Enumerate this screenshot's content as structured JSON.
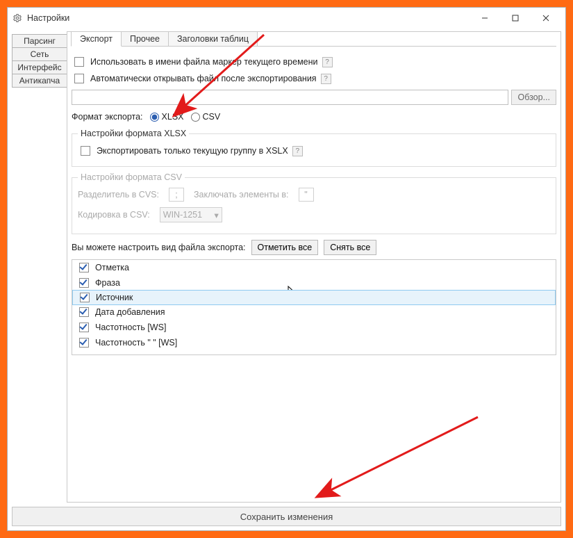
{
  "window": {
    "title": "Настройки",
    "controls": {
      "min": "–",
      "max": "☐",
      "close": "✕"
    }
  },
  "side_tabs": [
    "Парсинг",
    "Сеть",
    "Интерфейс",
    "Антикапча"
  ],
  "top_tabs": [
    "Экспорт",
    "Прочее",
    "Заголовки таблиц"
  ],
  "export": {
    "use_time_marker_label": "Использовать в имени файла маркер текущего времени",
    "auto_open_label": "Автоматически открывать файл после экспортирования",
    "browse_button": "Обзор...",
    "format_label": "Формат экспорта:",
    "format_xlsx": "XLSX",
    "format_csv": "CSV",
    "xlsx_group_title": "Настройки формата XLSX",
    "xlsx_only_current": "Экспортировать только текущую группу в XSLX",
    "csv_group_title": "Настройки формата CSV",
    "csv_sep_label": "Разделитель в CVS:",
    "csv_sep_value": ";",
    "csv_quote_label": "Заключать элементы в:",
    "csv_quote_value": "\"",
    "csv_enc_label": "Кодировка в CSV:",
    "csv_enc_value": "WIN-1251",
    "columns_hint": "Вы можете настроить вид файла экспорта:",
    "mark_all": "Отметить все",
    "unmark_all": "Снять все",
    "columns": [
      {
        "label": "Отметка",
        "checked": true,
        "selected": false
      },
      {
        "label": "Фраза",
        "checked": true,
        "selected": false
      },
      {
        "label": "Источник",
        "checked": true,
        "selected": true
      },
      {
        "label": "Дата добавления",
        "checked": true,
        "selected": false
      },
      {
        "label": "Частотность [WS]",
        "checked": true,
        "selected": false
      },
      {
        "label": "Частотность \" \" [WS]",
        "checked": true,
        "selected": false
      }
    ]
  },
  "save_button": "Сохранить изменения"
}
